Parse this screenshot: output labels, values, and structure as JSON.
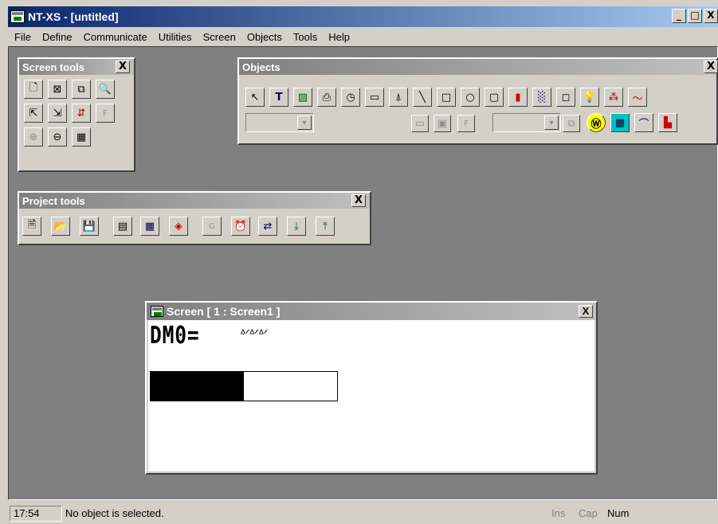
{
  "window": {
    "title": "NT-XS - [untitled]",
    "min": "_",
    "max": "□",
    "close": "X"
  },
  "menu": [
    "File",
    "Define",
    "Communicate",
    "Utilities",
    "Screen",
    "Objects",
    "Tools",
    "Help"
  ],
  "screen_tools": {
    "title": "Screen tools",
    "close": "X",
    "buttons": [
      "new-screen",
      "delete-screen",
      "copy-screen",
      "find-screen",
      "previous-screen",
      "next-screen",
      "screen-properties",
      "F",
      "zoom-in",
      "zoom-out",
      "grid"
    ]
  },
  "objects": {
    "title": "Objects",
    "close": "X",
    "buttons": [
      "select-pointer",
      "T",
      "bitmap",
      "chart-recorder",
      "clock",
      "text-display",
      "alarm-bell",
      "line",
      "rectangle",
      "circle",
      "rounded-rect",
      "thermometer",
      "bitmap-fill",
      "frame",
      "lamp",
      "graph",
      "trend"
    ]
  },
  "project_tools": {
    "title": "Project tools",
    "close": "X",
    "buttons": [
      "new-project",
      "open-project",
      "save-project",
      "screen-list",
      "table",
      "layers",
      "G",
      "alarm",
      "transfer",
      "download",
      "upload"
    ]
  },
  "screen_window": {
    "title": "Screen [ 1 : Screen1 ]",
    "close": "X",
    "dm_label": "DM0=",
    "dm_value": "ᐞᐟᐞᐟᐞᐟ",
    "bar_progress": 0.5
  },
  "status": {
    "time": "17:54",
    "message": "No object is selected.",
    "ins": "Ins",
    "cap": "Cap",
    "num": "Num"
  }
}
